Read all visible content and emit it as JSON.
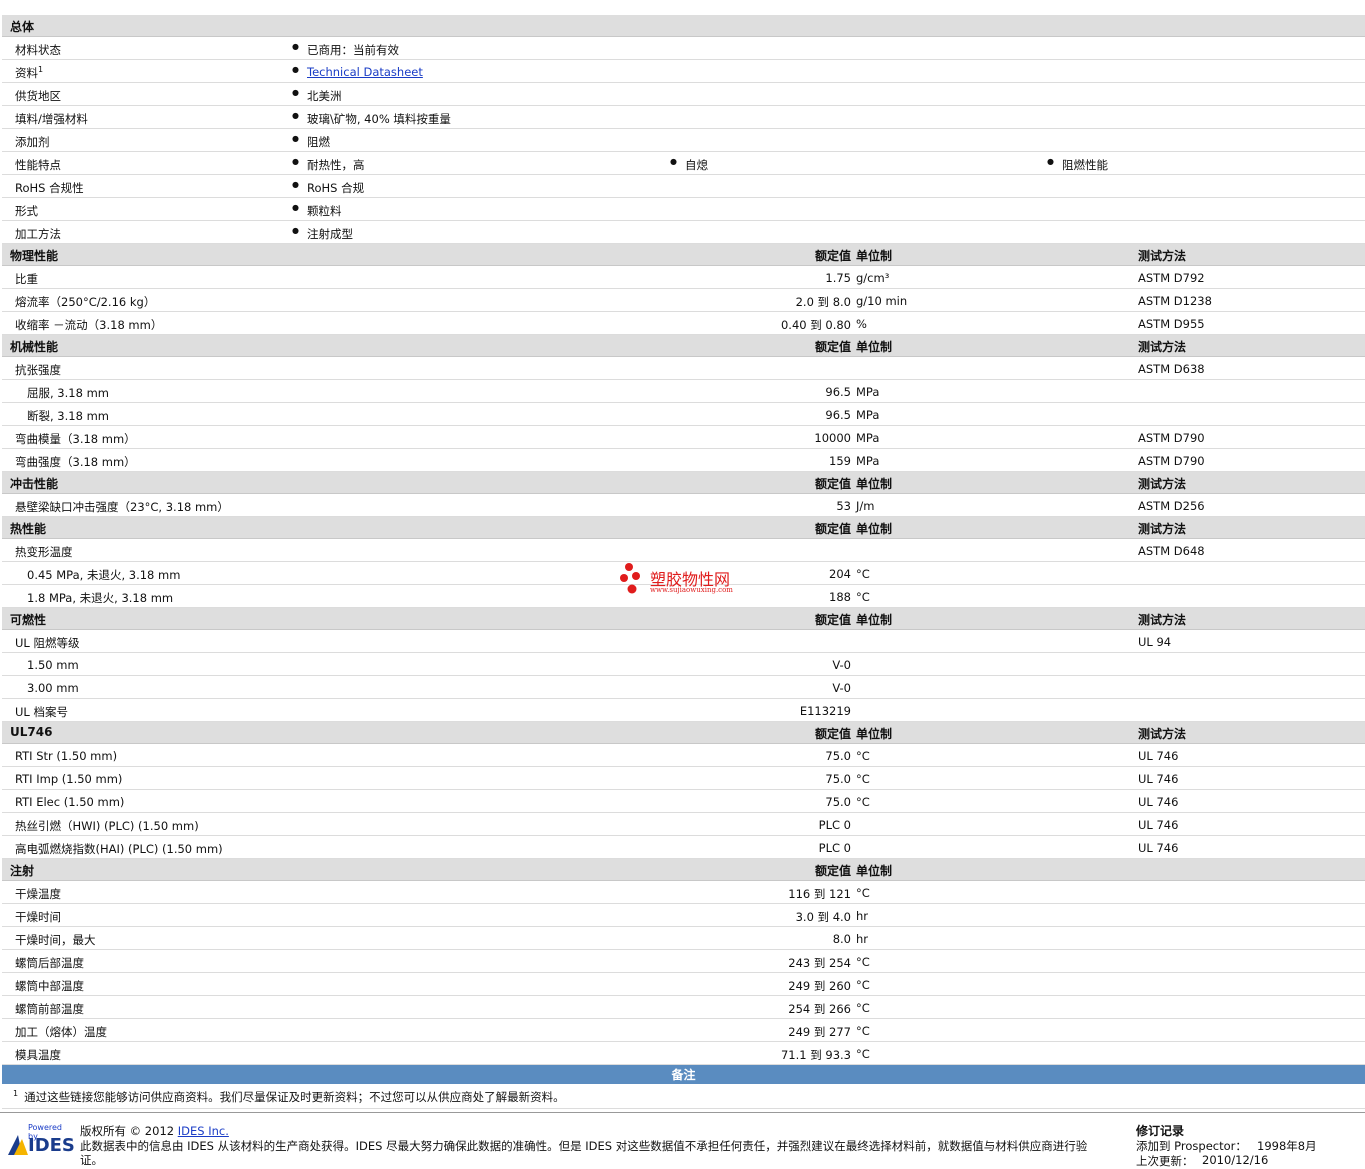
{
  "general": {
    "header": "总体",
    "rows": [
      {
        "label": "材料状态",
        "items": [
          "已商用：当前有效"
        ]
      },
      {
        "label": "资料",
        "sup": "1",
        "items": [
          "Technical Datasheet"
        ],
        "link": true
      },
      {
        "label": "供货地区",
        "items": [
          "北美洲"
        ]
      },
      {
        "label": "填料/增强材料",
        "items": [
          "玻璃\\矿物, 40% 填料按重量"
        ]
      },
      {
        "label": "添加剂",
        "items": [
          "阻燃"
        ]
      },
      {
        "label": "性能特点",
        "items": [
          "耐热性，高",
          "自熄",
          "阻燃性能"
        ]
      },
      {
        "label": "RoHS 合规性",
        "items": [
          "RoHS 合规"
        ]
      },
      {
        "label": "形式",
        "items": [
          "颗粒料"
        ]
      },
      {
        "label": "加工方法",
        "items": [
          "注射成型"
        ]
      }
    ]
  },
  "columns": {
    "nominal": "额定值",
    "unit": "单位制",
    "test": "测试方法"
  },
  "sections": [
    {
      "title": "物理性能",
      "show_test": true,
      "rows": [
        {
          "label": "比重",
          "value": "1.75",
          "unit": "g/cm³",
          "test": "ASTM D792"
        },
        {
          "label": "熔流率（250°C/2.16 kg）",
          "value": "2.0 到  8.0",
          "unit": "g/10 min",
          "test": "ASTM D1238"
        },
        {
          "label": "收缩率 －流动（3.18 mm）",
          "value": "0.40 到  0.80",
          "unit": "%",
          "test": "ASTM D955"
        }
      ]
    },
    {
      "title": "机械性能",
      "show_test": true,
      "rows": [
        {
          "label": "抗张强度",
          "value": "",
          "unit": "",
          "test": "ASTM D638"
        },
        {
          "label": "屈服, 3.18 mm",
          "sub": true,
          "value": "96.5",
          "unit": "MPa",
          "test": ""
        },
        {
          "label": "断裂, 3.18 mm",
          "sub": true,
          "value": "96.5",
          "unit": "MPa",
          "test": ""
        },
        {
          "label": "弯曲模量（3.18 mm）",
          "value": "10000",
          "unit": "MPa",
          "test": "ASTM D790"
        },
        {
          "label": "弯曲强度（3.18 mm）",
          "value": "159",
          "unit": "MPa",
          "test": "ASTM D790"
        }
      ]
    },
    {
      "title": "冲击性能",
      "show_test": true,
      "rows": [
        {
          "label": "悬壁梁缺口冲击强度（23°C, 3.18 mm）",
          "value": "53",
          "unit": "J/m",
          "test": "ASTM D256"
        }
      ]
    },
    {
      "title": "热性能",
      "show_test": true,
      "rows": [
        {
          "label": "热变形温度",
          "value": "",
          "unit": "",
          "test": "ASTM D648"
        },
        {
          "label": "0.45 MPa, 未退火, 3.18 mm",
          "sub": true,
          "value": "204",
          "unit": "°C",
          "test": ""
        },
        {
          "label": "1.8 MPa, 未退火, 3.18 mm",
          "sub": true,
          "value": "188",
          "unit": "°C",
          "test": ""
        }
      ]
    },
    {
      "title": "可燃性",
      "show_test": true,
      "rows": [
        {
          "label": "UL 阻燃等级",
          "value": "",
          "unit": "",
          "test": "UL 94"
        },
        {
          "label": "1.50 mm",
          "sub": true,
          "value": "V-0",
          "unit": "",
          "test": ""
        },
        {
          "label": "3.00 mm",
          "sub": true,
          "value": "V-0",
          "unit": "",
          "test": ""
        },
        {
          "label": "UL 档案号",
          "value": "E113219",
          "unit": "",
          "test": ""
        }
      ]
    },
    {
      "title": "UL746",
      "show_test": true,
      "rows": [
        {
          "label": "RTI Str (1.50 mm)",
          "value": "75.0",
          "unit": "°C",
          "test": "UL 746"
        },
        {
          "label": "RTI Imp (1.50 mm)",
          "value": "75.0",
          "unit": "°C",
          "test": "UL 746"
        },
        {
          "label": "RTI Elec (1.50 mm)",
          "value": "75.0",
          "unit": "°C",
          "test": "UL 746"
        },
        {
          "label": "热丝引燃（HWI) (PLC) (1.50 mm)",
          "value": "PLC 0",
          "unit": "",
          "test": "UL 746"
        },
        {
          "label": "高电弧燃烧指数(HAI) (PLC) (1.50 mm)",
          "value": "PLC 0",
          "unit": "",
          "test": "UL 746"
        }
      ]
    },
    {
      "title": "注射",
      "show_test": false,
      "rows": [
        {
          "label": "干燥温度",
          "value": "116 到  121",
          "unit": "°C",
          "test": ""
        },
        {
          "label": "干燥时间",
          "value": "3.0 到  4.0",
          "unit": "hr",
          "test": ""
        },
        {
          "label": "干燥时间，最大",
          "value": "8.0",
          "unit": "hr",
          "test": ""
        },
        {
          "label": "螺筒后部温度",
          "value": "243 到  254",
          "unit": "°C",
          "test": ""
        },
        {
          "label": "螺筒中部温度",
          "value": "249 到  260",
          "unit": "°C",
          "test": ""
        },
        {
          "label": "螺筒前部温度",
          "value": "254 到  266",
          "unit": "°C",
          "test": ""
        },
        {
          "label": "加工（熔体）温度",
          "value": "249 到  277",
          "unit": "°C",
          "test": ""
        },
        {
          "label": "模具温度",
          "value": "71.1 到  93.3",
          "unit": "°C",
          "test": ""
        }
      ]
    }
  ],
  "remarks": {
    "title": "备注",
    "note_sup": "1",
    "note": "通过这些链接您能够访问供应商资料。我们尽量保证及时更新资料；不过您可以从供应商处了解最新资料。"
  },
  "watermark": {
    "text": "塑胶物性网",
    "url": "www.sujiaowuxing.com",
    "color": "#e01c1c"
  },
  "footer": {
    "powered_by": "Powered by",
    "logo_text": "IDES",
    "copyright_prefix": "版权所有 © 2012 ",
    "copyright_link": "IDES Inc.",
    "disclaimer_line1": "此数据表中的信息由 IDES 从该材料的生产商处获得。IDES 尽最大努力确保此数据的准确性。但是 IDES 对这些数据值不承担任何责任，并强烈建议在最终选择材料前，就数据值与材料供应商进行验",
    "disclaimer_line2": "证。",
    "revision_title": "修订记录",
    "added_label": "添加到 Prospector：",
    "added_value": "1998年8月",
    "updated_label": "上次更新：",
    "updated_value": "2010/12/16"
  }
}
